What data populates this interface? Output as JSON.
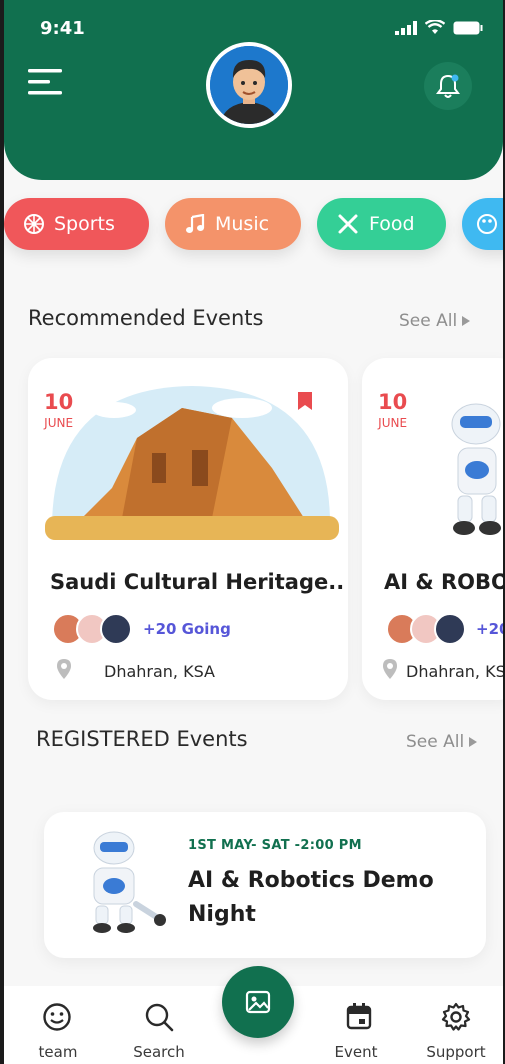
{
  "status_bar": {
    "time": "9:41"
  },
  "categories": [
    {
      "label": "Sports",
      "icon": "ball-icon",
      "color": "#f0575a"
    },
    {
      "label": "Music",
      "icon": "music-note-icon",
      "color": "#f4936a"
    },
    {
      "label": "Food",
      "icon": "utensils-icon",
      "color": "#34cf96"
    },
    {
      "label": "",
      "icon": "palette-icon",
      "color": "#3fb9f1"
    }
  ],
  "recommended": {
    "title": "Recommended Events",
    "see_all": "See All",
    "events": [
      {
        "day": "10",
        "month": "JUNE",
        "title": "Saudi Cultural Heritage...",
        "going": "+20 Going",
        "location": "Dhahran, KSA"
      },
      {
        "day": "10",
        "month": "JUNE",
        "title": "AI & ROBO",
        "going": "+20",
        "location": "Dhahran, KS"
      }
    ]
  },
  "registered": {
    "title": "REGISTERED Events",
    "see_all": "See All",
    "event": {
      "date": "1ST MAY- SAT -2:00 PM",
      "title": "AI & Robotics Demo Night"
    }
  },
  "nav": {
    "items": [
      {
        "label": "team",
        "icon": "smiley-icon"
      },
      {
        "label": "Search",
        "icon": "search-icon"
      },
      {
        "label": "Event",
        "icon": "calendar-icon"
      },
      {
        "label": "Support",
        "icon": "gear-icon"
      }
    ]
  },
  "colors": {
    "brand": "#11704f",
    "accent_red": "#e94b4f",
    "going": "#5656d8"
  }
}
